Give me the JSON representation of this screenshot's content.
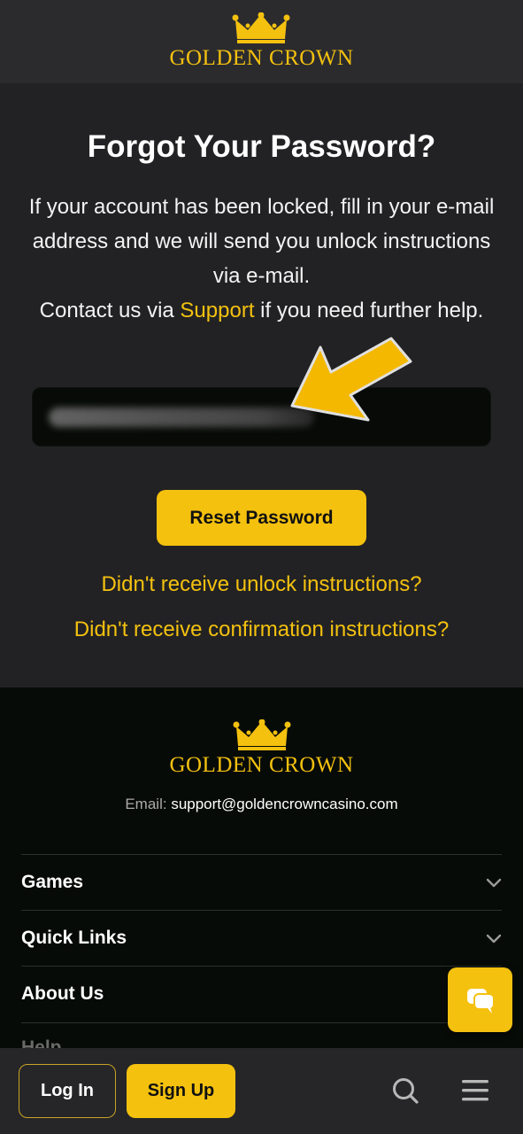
{
  "brand": {
    "name": "GOLDEN CROWN",
    "accent": "#f4c10f"
  },
  "page": {
    "title": "Forgot Your Password?",
    "desc_line1": "If your account has been locked, fill in your e-mail address and we will send you unlock instructions via e-mail.",
    "desc_contact_prefix": "Contact us via",
    "desc_support_link": "Support",
    "desc_contact_suffix": "if you need further help.",
    "email_value": "",
    "reset_button": "Reset Password",
    "unlock_link": "Didn't receive unlock instructions?",
    "confirm_link": "Didn't receive confirmation instructions?"
  },
  "footer": {
    "email_label": "Email:",
    "email_value": "support@goldencrowncasino.com",
    "sections": [
      "Games",
      "Quick Links",
      "About Us",
      "Help"
    ]
  },
  "bottom_bar": {
    "login": "Log In",
    "signup": "Sign Up"
  },
  "icons": [
    "crown-icon",
    "arrow-pointer-icon",
    "chevron-down-icon",
    "chat-icon",
    "search-icon",
    "menu-icon"
  ]
}
